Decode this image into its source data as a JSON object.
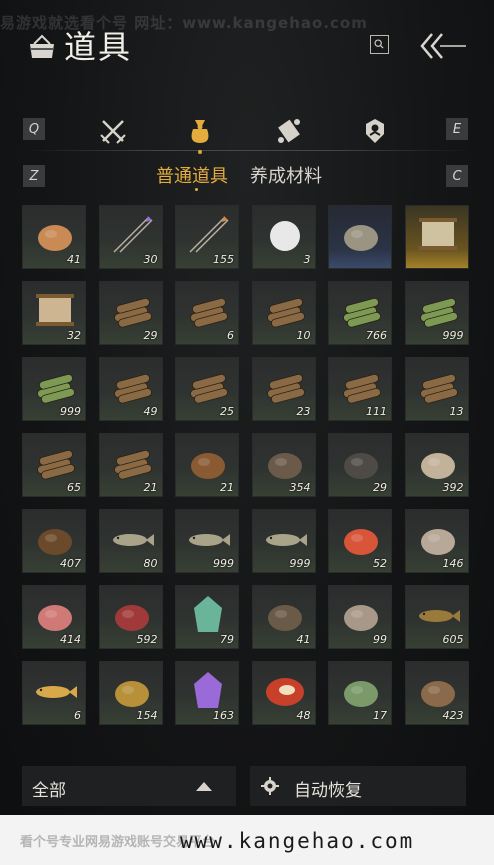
{
  "watermark_top": "易游戏就选看个号   网址：www.kangehao.com",
  "header": {
    "title": "道具"
  },
  "tabs": {
    "prev_key": "Q",
    "next_key": "E",
    "items": [
      {
        "name": "weapons",
        "icon": "crossed-swords-icon"
      },
      {
        "name": "items",
        "icon": "pouch-icon",
        "active": true
      },
      {
        "name": "scrolls",
        "icon": "scroll-icon"
      },
      {
        "name": "tokens",
        "icon": "badge-icon"
      }
    ]
  },
  "subtabs": {
    "prev_key": "Z",
    "next_key": "C",
    "items": [
      "普通道具",
      "养成材料"
    ],
    "active": 0
  },
  "items": [
    {
      "count": "41",
      "icon": "grain-pile-icon",
      "tone": "normal"
    },
    {
      "count": "30",
      "icon": "purple-arrows-icon",
      "tone": "normal"
    },
    {
      "count": "155",
      "icon": "fire-arrows-icon",
      "tone": "normal"
    },
    {
      "count": "3",
      "icon": "snowball-icon",
      "tone": "normal"
    },
    {
      "count": "",
      "icon": "ore-stone-icon",
      "tone": "rare"
    },
    {
      "count": "",
      "icon": "painting-scroll-icon",
      "tone": "legend"
    },
    {
      "count": "32",
      "icon": "paper-scroll-icon",
      "tone": "normal"
    },
    {
      "count": "29",
      "icon": "logs-icon",
      "tone": "normal"
    },
    {
      "count": "6",
      "icon": "logs-icon",
      "tone": "normal"
    },
    {
      "count": "10",
      "icon": "logs-icon",
      "tone": "normal"
    },
    {
      "count": "766",
      "icon": "bamboo-icon",
      "tone": "normal"
    },
    {
      "count": "999",
      "icon": "bamboo-icon",
      "tone": "normal"
    },
    {
      "count": "999",
      "icon": "bamboo-icon",
      "tone": "normal"
    },
    {
      "count": "49",
      "icon": "logs-icon",
      "tone": "normal"
    },
    {
      "count": "25",
      "icon": "logs-icon",
      "tone": "normal"
    },
    {
      "count": "23",
      "icon": "logs-icon",
      "tone": "normal"
    },
    {
      "count": "111",
      "icon": "logs-icon",
      "tone": "normal"
    },
    {
      "count": "13",
      "icon": "logs-icon",
      "tone": "normal"
    },
    {
      "count": "65",
      "icon": "logs-icon",
      "tone": "normal"
    },
    {
      "count": "21",
      "icon": "logs-icon",
      "tone": "normal"
    },
    {
      "count": "21",
      "icon": "hay-bundle-icon",
      "tone": "normal"
    },
    {
      "count": "354",
      "icon": "charcoal-icon",
      "tone": "normal"
    },
    {
      "count": "29",
      "icon": "dark-stone-icon",
      "tone": "normal"
    },
    {
      "count": "392",
      "icon": "mushroom-cluster-icon",
      "tone": "normal"
    },
    {
      "count": "407",
      "icon": "cricket-icon",
      "tone": "normal"
    },
    {
      "count": "80",
      "icon": "fish-icon",
      "tone": "normal"
    },
    {
      "count": "999",
      "icon": "fish-icon",
      "tone": "normal"
    },
    {
      "count": "999",
      "icon": "fish-icon",
      "tone": "normal"
    },
    {
      "count": "52",
      "icon": "berries-icon",
      "tone": "normal"
    },
    {
      "count": "146",
      "icon": "mushrooms-icon",
      "tone": "normal"
    },
    {
      "count": "414",
      "icon": "raw-meat-icon",
      "tone": "normal"
    },
    {
      "count": "592",
      "icon": "steak-icon",
      "tone": "normal"
    },
    {
      "count": "79",
      "icon": "jade-stone-icon",
      "tone": "normal"
    },
    {
      "count": "41",
      "icon": "feathers-icon",
      "tone": "normal"
    },
    {
      "count": "99",
      "icon": "hide-icon",
      "tone": "normal"
    },
    {
      "count": "605",
      "icon": "catfish-icon",
      "tone": "normal"
    },
    {
      "count": "6",
      "icon": "golden-carp-icon",
      "tone": "normal"
    },
    {
      "count": "154",
      "icon": "gold-ore-icon",
      "tone": "normal"
    },
    {
      "count": "163",
      "icon": "amethyst-icon",
      "tone": "normal"
    },
    {
      "count": "48",
      "icon": "red-gem-icon",
      "tone": "normal"
    },
    {
      "count": "17",
      "icon": "herb-icon",
      "tone": "normal"
    },
    {
      "count": "423",
      "icon": "mortar-icon",
      "tone": "normal"
    }
  ],
  "bottom": {
    "filter_label": "全部",
    "auto_label": "自动恢复"
  },
  "footer": {
    "text": "看个号专业网易游戏账号交易平台",
    "url": "www.kangehao.com"
  },
  "colors": {
    "accent": "#e4ab3d",
    "panel": "#1e2021",
    "background": "#121314"
  }
}
